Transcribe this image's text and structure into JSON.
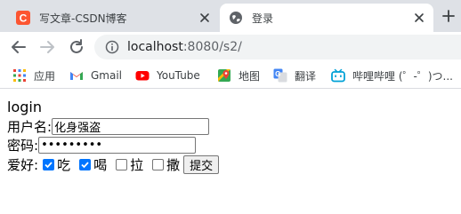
{
  "tabs": [
    {
      "title": "写文章-CSDN博客",
      "favicon_letter": "C",
      "favicon_color": "#fc5531",
      "active": false
    },
    {
      "title": "登录",
      "active": true
    }
  ],
  "toolbar": {
    "url_host": "localhost",
    "url_rest": ":8080/s2/"
  },
  "bookmarks": [
    {
      "label": "应用",
      "icon": "apps-grid-icon"
    },
    {
      "label": "Gmail",
      "icon": "gmail-icon"
    },
    {
      "label": "YouTube",
      "icon": "youtube-icon"
    },
    {
      "label": "地图",
      "icon": "maps-icon"
    },
    {
      "label": "翻译",
      "icon": "translate-icon"
    },
    {
      "label": "哔哩哔哩 (゜-゜)つ...",
      "icon": "bilibili-icon"
    }
  ],
  "form": {
    "heading": "login",
    "username_label": "用户名:",
    "username_value": "化身强盗",
    "password_label": "密码:",
    "password_mask": "•••••••••",
    "hobby_label": "爱好:",
    "hobbies": [
      {
        "label": "吃",
        "checked": true
      },
      {
        "label": "喝",
        "checked": true
      },
      {
        "label": "拉",
        "checked": false
      },
      {
        "label": "撒",
        "checked": false
      }
    ],
    "submit_label": "提交"
  },
  "colors": {
    "tabstrip": "#dee1e6",
    "checkbox_checked": "#0075ff",
    "youtube_red": "#ff0000",
    "bilibili_blue": "#00a1d6"
  }
}
